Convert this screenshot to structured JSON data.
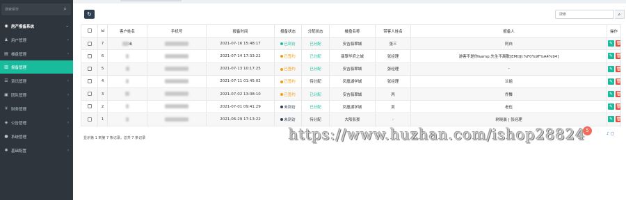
{
  "sidebar": {
    "search_placeholder": "搜索菜单",
    "items": [
      {
        "icon": "dashboard-icon",
        "glyph": "◉",
        "label": "房产报备系统",
        "chev": "⌄"
      },
      {
        "icon": "user-icon",
        "glyph": "♟",
        "label": "用户管理",
        "chev": "‹"
      },
      {
        "icon": "building-icon",
        "glyph": "▤",
        "label": "楼盘管理",
        "chev": "‹"
      },
      {
        "icon": "report-icon",
        "glyph": "▥",
        "label": "报备管理",
        "chev": "‹"
      },
      {
        "icon": "news-icon",
        "glyph": "☰",
        "label": "资讯管理",
        "chev": "‹"
      },
      {
        "icon": "team-icon",
        "glyph": "▣",
        "label": "团队管理",
        "chev": "‹"
      },
      {
        "icon": "finance-icon",
        "glyph": "¥",
        "label": "财务管理",
        "chev": "‹"
      },
      {
        "icon": "notice-icon",
        "glyph": "◈",
        "label": "公告管理",
        "chev": "‹"
      },
      {
        "icon": "config-icon",
        "glyph": "●",
        "label": "系统管理",
        "chev": "‹"
      },
      {
        "icon": "gear-icon",
        "glyph": "✱",
        "label": "基础配置",
        "chev": "‹"
      }
    ]
  },
  "toolbar": {
    "refresh_glyph": "↻",
    "search_placeholder": "搜索",
    "search_glyph": "⌕"
  },
  "table": {
    "headers": [
      "",
      "id",
      "客户姓名",
      "手机号",
      "报备时间",
      "报备状态",
      "分配状态",
      "楼盘名称",
      "带客人姓名",
      "报备人",
      "操作"
    ],
    "rows": [
      {
        "id": "7",
        "name_tail": "出",
        "time": "2021-07-16 15:48:17",
        "status": "已到访",
        "status_color": "#18bc9c",
        "assign": "已分配",
        "assign_style": "green",
        "project": "安吉翡翠城",
        "agent": "张三",
        "reporter": "阿白"
      },
      {
        "id": "6",
        "name_tail": "",
        "time": "2021-07-14 17:33:22",
        "status": "已签约",
        "status_color": "#f39c12",
        "assign": "已分配",
        "assign_style": "green",
        "project": "翡翠华府之城",
        "agent": "张经理",
        "reporter": "游客不是你&amp;先生不离散[EMOJI:%F0%9F%A4%94]"
      },
      {
        "id": "5",
        "name_tail": "",
        "time": "2021-07-13 10:17:25",
        "status": "已签约",
        "status_color": "#f39c12",
        "assign": "已分配",
        "assign_style": "green",
        "project": "安吉翡翠城",
        "agent": "张经理",
        "reporter": "-"
      },
      {
        "id": "4",
        "name_tail": "",
        "time": "2021-07-11 01:45:02",
        "status": "已签约",
        "status_color": "#f39c12",
        "assign": "待分配",
        "assign_style": "plain",
        "project": "凤凰湖学城",
        "agent": "张经理",
        "reporter": "兰姐"
      },
      {
        "id": "3",
        "name_tail": "",
        "time": "2021-07-02 13:08:10",
        "status": "已签约",
        "status_color": "#f39c12",
        "assign": "已分配",
        "assign_style": "green",
        "project": "安吉翡翠城",
        "agent": "丙",
        "reporter": "乔舞"
      },
      {
        "id": "2",
        "name_tail": "",
        "time": "2021-07-01 09:41:29",
        "status": "未到访",
        "status_color": "#2c3e50",
        "assign": "已分配",
        "assign_style": "green",
        "project": "凤凰湖学城",
        "agent": "吴",
        "reporter": "老伍"
      },
      {
        "id": "1",
        "name_tail": "",
        "time": "2021-06-29 17:13:22",
        "status": "未到访",
        "status_color": "#2c3e50",
        "assign": "待分配",
        "assign_style": "plain",
        "project": "大阪影豪",
        "agent": "-",
        "reporter": "树晓晨 | 张经理"
      }
    ],
    "edit_glyph": "✎",
    "delete_glyph": "🗑"
  },
  "pager": {
    "text": "显示第 1 到第 7 条记录，总共 7 条记录"
  },
  "watermark": {
    "text": "https://www.huzhan.com/ishop28824",
    "badge": "5",
    "tools": "♪ ▢"
  }
}
